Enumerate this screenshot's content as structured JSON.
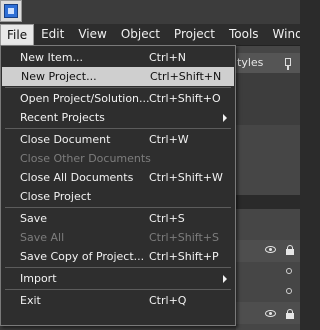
{
  "menubar": {
    "items": [
      {
        "label": "File",
        "active": true
      },
      {
        "label": "Edit"
      },
      {
        "label": "View"
      },
      {
        "label": "Object"
      },
      {
        "label": "Project"
      },
      {
        "label": "Tools"
      },
      {
        "label": "Window"
      }
    ]
  },
  "background": {
    "panel_tab_label": "tyles"
  },
  "file_menu": {
    "items": [
      {
        "label": "New Item...",
        "shortcut": "Ctrl+N"
      },
      {
        "label": "New Project...",
        "shortcut": "Ctrl+Shift+N",
        "state": "hover"
      },
      {
        "separator": true
      },
      {
        "label": "Open Project/Solution...",
        "shortcut": "Ctrl+Shift+O"
      },
      {
        "label": "Recent Projects",
        "submenu": true
      },
      {
        "separator": true
      },
      {
        "label": "Close Document",
        "shortcut": "Ctrl+W"
      },
      {
        "label": "Close Other Documents",
        "state": "disabled"
      },
      {
        "label": "Close All Documents",
        "shortcut": "Ctrl+Shift+W"
      },
      {
        "label": "Close Project"
      },
      {
        "separator": true
      },
      {
        "label": "Save",
        "shortcut": "Ctrl+S"
      },
      {
        "label": "Save All",
        "shortcut": "Ctrl+Shift+S",
        "state": "disabled"
      },
      {
        "label": "Save Copy of Project...",
        "shortcut": "Ctrl+Shift+P"
      },
      {
        "separator": true
      },
      {
        "label": "Import",
        "submenu": true
      },
      {
        "separator": true
      },
      {
        "label": "Exit",
        "shortcut": "Ctrl+Q"
      }
    ]
  }
}
